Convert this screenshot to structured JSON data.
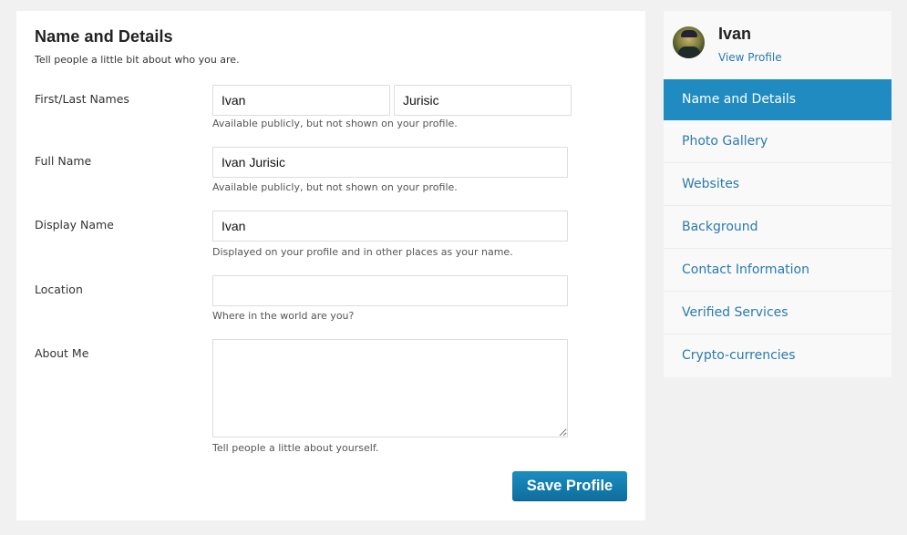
{
  "form": {
    "title": "Name and Details",
    "subtitle": "Tell people a little bit about who you are.",
    "fields": {
      "names": {
        "label": "First/Last Names",
        "first_value": "Ivan",
        "last_value": "Jurisic",
        "hint": "Available publicly, but not shown on your profile."
      },
      "full_name": {
        "label": "Full Name",
        "value": "Ivan Jurisic",
        "hint": "Available publicly, but not shown on your profile."
      },
      "display_name": {
        "label": "Display Name",
        "value": "Ivan",
        "hint": "Displayed on your profile and in other places as your name."
      },
      "location": {
        "label": "Location",
        "value": "",
        "hint": "Where in the world are you?"
      },
      "about_me": {
        "label": "About Me",
        "value": "",
        "hint": "Tell people a little about yourself."
      }
    },
    "save_label": "Save Profile"
  },
  "sidebar": {
    "profile_name": "Ivan",
    "view_profile_label": "View Profile",
    "items": [
      {
        "label": "Name and Details",
        "active": true
      },
      {
        "label": "Photo Gallery",
        "active": false
      },
      {
        "label": "Websites",
        "active": false
      },
      {
        "label": "Background",
        "active": false
      },
      {
        "label": "Contact Information",
        "active": false
      },
      {
        "label": "Verified Services",
        "active": false
      },
      {
        "label": "Crypto-currencies",
        "active": false
      }
    ]
  },
  "colors": {
    "accent": "#1f8bc0",
    "link": "#2a7ab0",
    "page_bg": "#f1f1f1"
  }
}
